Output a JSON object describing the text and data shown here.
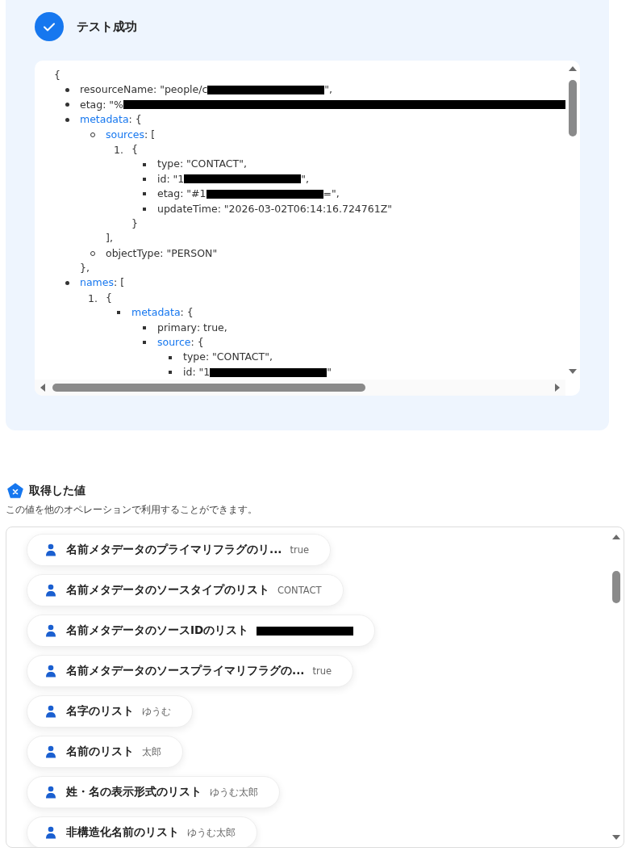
{
  "result": {
    "title": "テスト成功",
    "code": {
      "open": "{",
      "kind": "disc",
      "items": [
        {
          "key": "resourceName",
          "link": false,
          "text": ": \"people/c",
          "redacted": true,
          "after": "\","
        },
        {
          "key": "etag",
          "link": false,
          "text": ": \"%",
          "redacted": true,
          "wide": true
        },
        {
          "key": "metadata",
          "link": true,
          "text": ": {",
          "close": "},",
          "children": {
            "kind": "circle",
            "items": [
              {
                "key": "sources",
                "link": true,
                "text": ": [",
                "close": "],",
                "children": {
                  "kind": "ordered",
                  "items": [
                    {
                      "number": "1.",
                      "text": "{",
                      "close": "}",
                      "children": {
                        "kind": "square",
                        "items": [
                          {
                            "key": "type",
                            "link": false,
                            "text": ": \"CONTACT\","
                          },
                          {
                            "key": "id",
                            "link": false,
                            "text": ": \"1",
                            "redacted": true,
                            "after": "\","
                          },
                          {
                            "key": "etag",
                            "link": false,
                            "text": ": \"#1",
                            "redacted": true,
                            "after": "=\","
                          },
                          {
                            "key": "updateTime",
                            "link": false,
                            "text": ": \"2026-03-02T06:14:16.724761Z\""
                          }
                        ]
                      }
                    }
                  ]
                }
              },
              {
                "key": "objectType",
                "link": false,
                "text": ": \"PERSON\""
              }
            ]
          }
        },
        {
          "key": "names",
          "link": true,
          "text": ": [",
          "children": {
            "kind": "ordered",
            "items": [
              {
                "number": "1.",
                "text": "{",
                "children": {
                  "kind": "square",
                  "items": [
                    {
                      "key": "metadata",
                      "link": true,
                      "text": ": {",
                      "children": {
                        "kind": "square",
                        "items": [
                          {
                            "key": "primary",
                            "link": false,
                            "text": ": true,"
                          },
                          {
                            "key": "source",
                            "link": true,
                            "text": ": {",
                            "children": {
                              "kind": "square",
                              "items": [
                                {
                                  "key": "type",
                                  "link": false,
                                  "text": ": \"CONTACT\","
                                },
                                {
                                  "key": "id",
                                  "link": false,
                                  "text": ": \"1",
                                  "redacted": true,
                                  "after": "\""
                                }
                              ]
                            }
                          }
                        ]
                      }
                    }
                  ]
                }
              }
            ]
          }
        }
      ]
    }
  },
  "values": {
    "title": "取得した値",
    "description": "この値を他のオペレーションで利用することができます。",
    "items": [
      {
        "label": "名前メタデータのプライマリフラグのリ...",
        "value": "true"
      },
      {
        "label": "名前メタデータのソースタイプのリスト",
        "value": "CONTACT"
      },
      {
        "label": "名前メタデータのソースIDのリスト",
        "redacted": true
      },
      {
        "label": "名前メタデータのソースプライマリフラグの...",
        "value": "true"
      },
      {
        "label": "名字のリスト",
        "value": "ゆうむ"
      },
      {
        "label": "名前のリスト",
        "value": "太郎"
      },
      {
        "label": "姓・名の表示形式のリスト",
        "value": "ゆうむ太郎"
      },
      {
        "label": "非構造化名前のリスト",
        "value": "ゆうむ太郎"
      }
    ]
  }
}
